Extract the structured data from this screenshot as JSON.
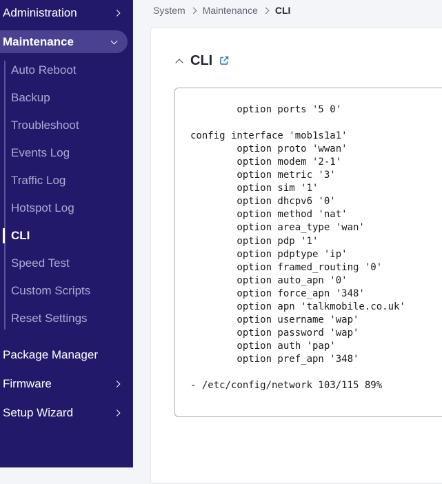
{
  "sidebar": {
    "top_items": [
      {
        "label": "Administration"
      }
    ],
    "active_section": {
      "label": "Maintenance"
    },
    "sub_items": [
      {
        "label": "Auto Reboot"
      },
      {
        "label": "Backup"
      },
      {
        "label": "Troubleshoot"
      },
      {
        "label": "Events Log"
      },
      {
        "label": "Traffic Log"
      },
      {
        "label": "Hotspot Log"
      },
      {
        "label": "CLI"
      },
      {
        "label": "Speed Test"
      },
      {
        "label": "Custom Scripts"
      },
      {
        "label": "Reset Settings"
      }
    ],
    "bottom_items": [
      {
        "label": "Package Manager"
      },
      {
        "label": "Firmware"
      },
      {
        "label": "Setup Wizard"
      }
    ]
  },
  "breadcrumb": {
    "items": [
      "System",
      "Maintenance",
      "CLI"
    ]
  },
  "section": {
    "title": "CLI"
  },
  "terminal": {
    "lines": [
      "        option ports '5 0'",
      "",
      "config interface 'mob1s1a1'",
      "        option proto 'wwan'",
      "        option modem '2-1'",
      "        option metric '3'",
      "        option sim '1'",
      "        option dhcpv6 '0'",
      "        option method 'nat'",
      "        option area_type 'wan'",
      "        option pdp '1'",
      "        option pdptype 'ip'",
      "        option framed_routing '0'",
      "        option auto_apn '0'",
      "        option force_apn '348'",
      "        option apn 'talkmobile.co.uk'",
      "        option username 'wap'",
      "        option password 'wap'",
      "        option auth 'pap'",
      "        option pref_apn '348'",
      "",
      "- /etc/config/network 103/115 89%"
    ]
  },
  "colors": {
    "sidebar_bg": "#23196a",
    "active_bg": "#4a4290",
    "link_icon": "#2c6fd6"
  }
}
